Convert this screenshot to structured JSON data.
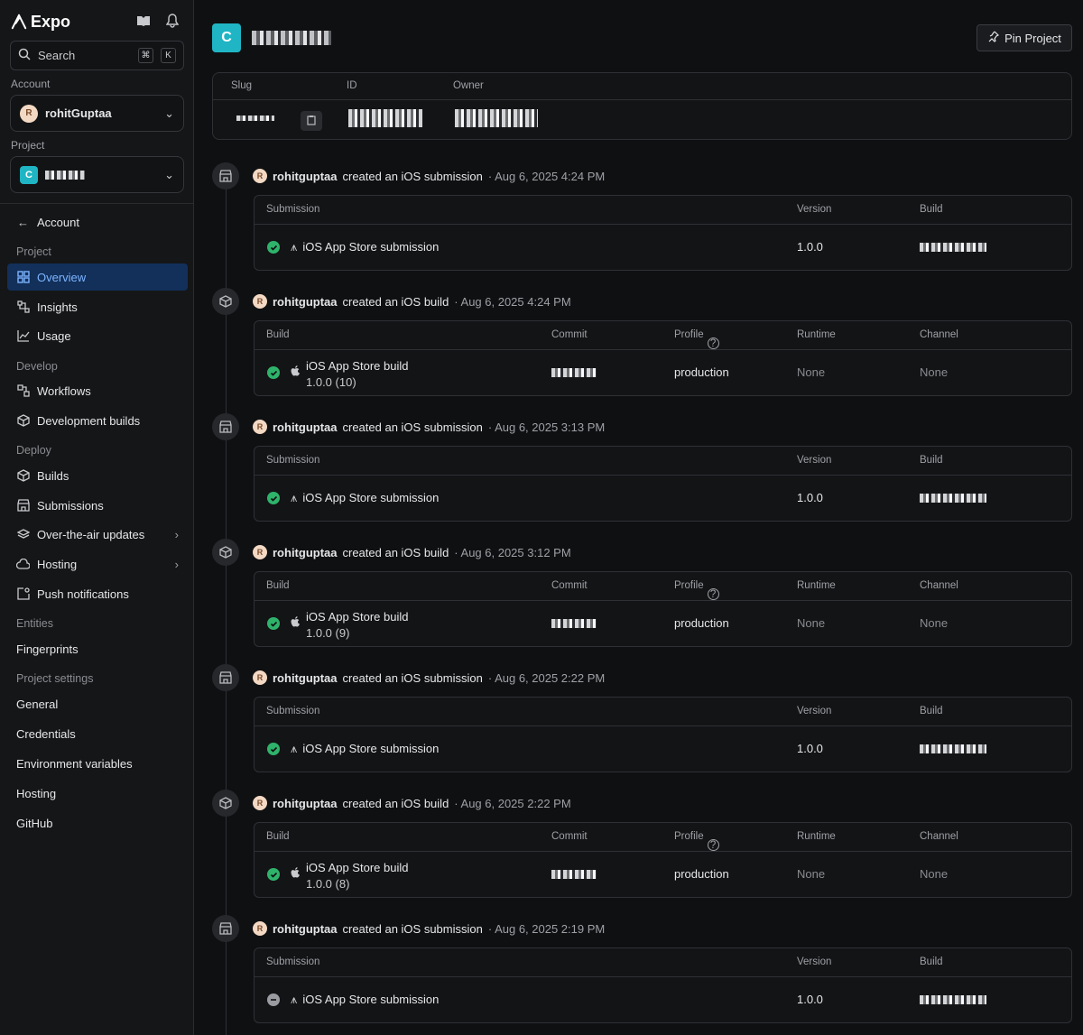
{
  "app": {
    "name": "Expo"
  },
  "sidebar": {
    "search": {
      "placeholder": "Search",
      "kbd1": "⌘",
      "kbd2": "K"
    },
    "account_label": "Account",
    "account_name": "rohitGuptaa",
    "account_initial": "R",
    "project_label": "Project",
    "project_initial": "C",
    "back_label": "Account",
    "sections": {
      "project": "Project",
      "develop": "Develop",
      "deploy": "Deploy",
      "entities": "Entities",
      "settings": "Project settings"
    },
    "items": {
      "overview": "Overview",
      "insights": "Insights",
      "usage": "Usage",
      "workflows": "Workflows",
      "dev_builds": "Development builds",
      "builds": "Builds",
      "submissions": "Submissions",
      "ota": "Over-the-air updates",
      "hosting": "Hosting",
      "push": "Push notifications",
      "fingerprints": "Fingerprints",
      "general": "General",
      "credentials": "Credentials",
      "env": "Environment variables",
      "hosting2": "Hosting",
      "github": "GitHub"
    }
  },
  "header": {
    "project_initial": "C",
    "pin_label": "Pin Project"
  },
  "meta": {
    "slug": "Slug",
    "id": "ID",
    "owner": "Owner"
  },
  "activity": [
    {
      "kind": "submission",
      "user": "rohitguptaa",
      "action": "created an iOS submission",
      "time": "· Aug 6, 2025 4:24 PM",
      "cols": [
        "Submission",
        "Version",
        "Build"
      ],
      "title": "iOS App Store submission",
      "version": "1.0.0",
      "status": "ok"
    },
    {
      "kind": "build",
      "user": "rohitguptaa",
      "action": "created an iOS build",
      "time": "· Aug 6, 2025 4:24 PM",
      "cols": [
        "Build",
        "Commit",
        "Profile",
        "Runtime",
        "Channel"
      ],
      "title": "iOS App Store build",
      "sub": "1.0.0 (10)",
      "profile": "production",
      "runtime": "None",
      "channel": "None",
      "status": "ok"
    },
    {
      "kind": "submission",
      "user": "rohitguptaa",
      "action": "created an iOS submission",
      "time": "· Aug 6, 2025 3:13 PM",
      "cols": [
        "Submission",
        "Version",
        "Build"
      ],
      "title": "iOS App Store submission",
      "version": "1.0.0",
      "status": "ok"
    },
    {
      "kind": "build",
      "user": "rohitguptaa",
      "action": "created an iOS build",
      "time": "· Aug 6, 2025 3:12 PM",
      "cols": [
        "Build",
        "Commit",
        "Profile",
        "Runtime",
        "Channel"
      ],
      "title": "iOS App Store build",
      "sub": "1.0.0 (9)",
      "profile": "production",
      "runtime": "None",
      "channel": "None",
      "status": "ok"
    },
    {
      "kind": "submission",
      "user": "rohitguptaa",
      "action": "created an iOS submission",
      "time": "· Aug 6, 2025 2:22 PM",
      "cols": [
        "Submission",
        "Version",
        "Build"
      ],
      "title": "iOS App Store submission",
      "version": "1.0.0",
      "status": "ok"
    },
    {
      "kind": "build",
      "user": "rohitguptaa",
      "action": "created an iOS build",
      "time": "· Aug 6, 2025 2:22 PM",
      "cols": [
        "Build",
        "Commit",
        "Profile",
        "Runtime",
        "Channel"
      ],
      "title": "iOS App Store build",
      "sub": "1.0.0 (8)",
      "profile": "production",
      "runtime": "None",
      "channel": "None",
      "status": "ok"
    },
    {
      "kind": "submission",
      "user": "rohitguptaa",
      "action": "created an iOS submission",
      "time": "· Aug 6, 2025 2:19 PM",
      "cols": [
        "Submission",
        "Version",
        "Build"
      ],
      "title": "iOS App Store submission",
      "version": "1.0.0",
      "status": "canceled"
    }
  ]
}
